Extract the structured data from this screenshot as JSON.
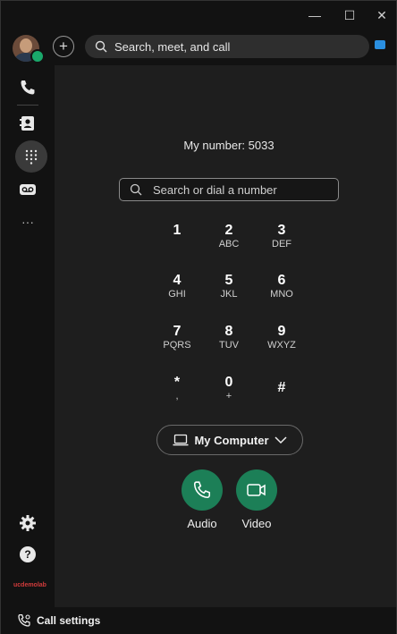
{
  "window_controls": {
    "minimize": "—",
    "maximize": "☐",
    "close": "✕"
  },
  "topbar": {
    "search_label": "Search, meet, and call",
    "add_label": "+"
  },
  "sidebar": {
    "items": [
      {
        "name": "calling",
        "icon": "phone-icon"
      },
      {
        "name": "contacts",
        "icon": "contacts-icon"
      },
      {
        "name": "dialpad",
        "icon": "dialpad-icon",
        "active": true
      },
      {
        "name": "voicemail",
        "icon": "voicemail-icon"
      },
      {
        "name": "more",
        "icon": "more-icon",
        "label": "···"
      }
    ],
    "bottom": [
      {
        "name": "settings",
        "icon": "gear-icon"
      },
      {
        "name": "help",
        "icon": "help-icon",
        "label": "?"
      }
    ],
    "brand": "ucdemolab"
  },
  "main": {
    "my_number": "My number: 5033",
    "dial_placeholder": "Search or dial a number",
    "keypad": [
      {
        "digit": "1",
        "letters": ""
      },
      {
        "digit": "2",
        "letters": "ABC"
      },
      {
        "digit": "3",
        "letters": "DEF"
      },
      {
        "digit": "4",
        "letters": "GHI"
      },
      {
        "digit": "5",
        "letters": "JKL"
      },
      {
        "digit": "6",
        "letters": "MNO"
      },
      {
        "digit": "7",
        "letters": "PQRS"
      },
      {
        "digit": "8",
        "letters": "TUV"
      },
      {
        "digit": "9",
        "letters": "WXYZ"
      },
      {
        "digit": "*",
        "letters": ","
      },
      {
        "digit": "0",
        "letters": "+"
      },
      {
        "digit": "#",
        "letters": ""
      }
    ],
    "device_button": "My Computer",
    "audio_label": "Audio",
    "video_label": "Video"
  },
  "footer": {
    "call_settings": "Call settings"
  },
  "colors": {
    "accent_green": "#1c7f57",
    "status_green": "#1aa86b",
    "background": "#1e1e1e"
  }
}
